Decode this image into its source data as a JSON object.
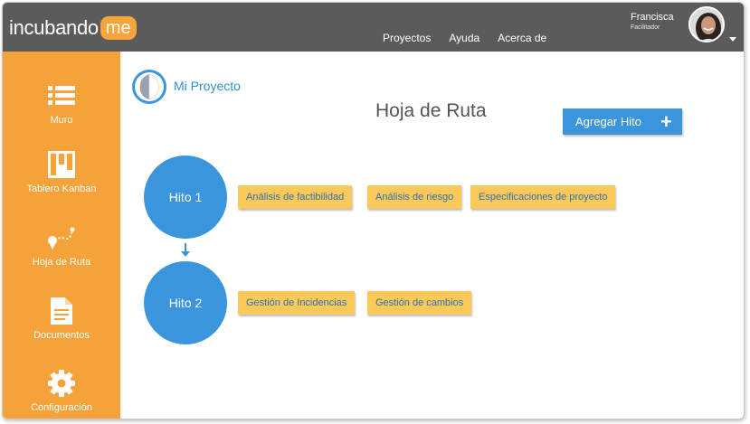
{
  "header": {
    "logo_text": "incubando",
    "logo_accent": "me",
    "nav": [
      "Proyectos",
      "Ayuda",
      "Acerca de"
    ],
    "user_name": "Francisca",
    "user_role": "Facilitador"
  },
  "sidebar": {
    "items": [
      {
        "label": "Muro",
        "icon": "list-icon"
      },
      {
        "label": "Tablero Kanban",
        "icon": "kanban-icon"
      },
      {
        "label": "Hoja de Ruta",
        "icon": "roadmap-icon"
      },
      {
        "label": "Documentos",
        "icon": "document-icon"
      },
      {
        "label": "Configuración",
        "icon": "gear-icon"
      }
    ]
  },
  "project": {
    "title": "Mi Proyecto"
  },
  "page": {
    "title": "Hoja de Ruta",
    "add_button": "Agregar Hito",
    "add_icon": "+"
  },
  "milestones": [
    {
      "label": "Hito 1",
      "tasks": [
        "Análisis de factibilidad",
        "Análisis de riesgo",
        "Especificaciones de proyecto"
      ]
    },
    {
      "label": "Hito 2",
      "tasks": [
        "Gestión de Incidencias",
        "Gestión de cambios"
      ]
    }
  ],
  "colors": {
    "accent": "#3a95dc",
    "sidebar": "#f6a23a",
    "header": "#5b5b5b",
    "task": "#fbc85a"
  }
}
